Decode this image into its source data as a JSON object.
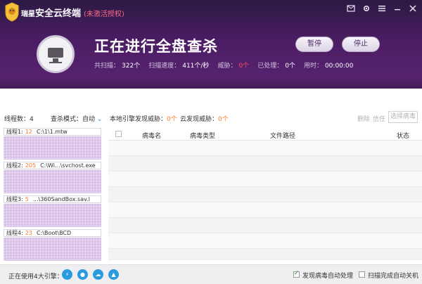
{
  "app": {
    "brand_prefix": "瑞星",
    "brand_name": "安全云终端",
    "license_status": "(未激活授权)"
  },
  "window_controls": [
    "message-icon",
    "gear-icon",
    "menu-icon",
    "minimize-icon",
    "close-icon"
  ],
  "scan": {
    "title": "正在进行全盘查杀",
    "pause_label": "暂停",
    "stop_label": "停止",
    "stats": [
      {
        "label": "共扫描：",
        "value": "322个",
        "color": "#ffffff"
      },
      {
        "label": "扫描速度：",
        "value": "411个/秒",
        "color": "#ffffff"
      },
      {
        "label": "威胁：",
        "value": "0个",
        "color": "#ff4a60"
      },
      {
        "label": "已处理：",
        "value": "0个",
        "color": "#ffffff"
      },
      {
        "label": "用时：",
        "value": "00:00:00",
        "color": "#ffffff"
      }
    ]
  },
  "toolbar": {
    "thread_count_label": "线程数：",
    "thread_count": "4",
    "mode_label": "查杀模式：",
    "mode_value": "自动",
    "local_label": "本地引擎发现威胁：",
    "local_value": "0个",
    "cloud_label": "云发现威胁：",
    "cloud_value": "0个",
    "delete_label": "删除",
    "trust_label": "信任",
    "select_label": "选择病毒"
  },
  "threads": [
    {
      "label": "线程1:",
      "count": "12",
      "path": "C:\\1\\1.mtw"
    },
    {
      "label": "线程2:",
      "count": "205",
      "path": "C:\\Wi...\\svchost.exe"
    },
    {
      "label": "线程3:",
      "count": "5",
      "path": "...\\360SandBox.sav.l"
    },
    {
      "label": "线程4:",
      "count": "23",
      "path": "C:\\Boot\\BCD"
    }
  ],
  "table": {
    "columns": [
      "病毒名",
      "病毒类型",
      "文件路径",
      "状态"
    ],
    "rows": []
  },
  "footer": {
    "engines_label": "正在使用4大引擎：",
    "engines": [
      "lightning-engine-icon",
      "person-engine-icon",
      "cloud-engine-icon",
      "triangle-engine-icon"
    ],
    "auto_process_label": "发现病毒自动处理",
    "auto_process_checked": true,
    "shutdown_label": "扫描完成自动关机",
    "shutdown_checked": false
  },
  "colors": {
    "accent_orange": "#ff7a2b",
    "accent_blue": "#2a86d6",
    "header_purple": "#4b1d63",
    "thread_fill": "#d9bfe8"
  }
}
